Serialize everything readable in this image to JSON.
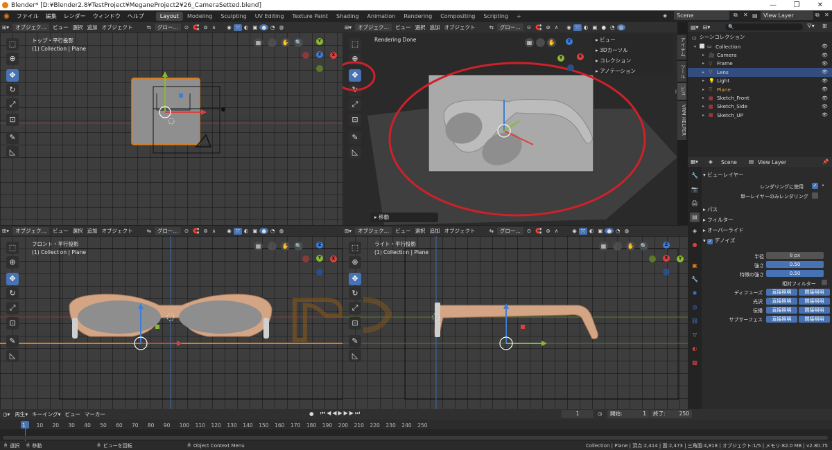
{
  "window": {
    "title": "Blender* [D:¥Blender2.8¥TestProject¥MeganeProject2¥26_CameraSetted.blend]",
    "minimize": "—",
    "maximize": "❐",
    "close": "✕"
  },
  "menu": [
    "ファイル",
    "編集",
    "レンダー",
    "ウィンドウ",
    "ヘルプ"
  ],
  "workspaces": [
    "Layout",
    "Modeling",
    "Sculpting",
    "UV Editing",
    "Texture Paint",
    "Shading",
    "Animation",
    "Rendering",
    "Compositing",
    "Scripting"
  ],
  "workspace_add": "+",
  "scene_name": "Scene",
  "view_layer": "View Layer",
  "vp_header": {
    "mode": "オブジェク…",
    "view": "ビュー",
    "select": "選択",
    "add": "追加",
    "object": "オブジェクト",
    "orientation": "グロー…"
  },
  "top_vp": {
    "view_name": "トップ・平行投影",
    "collection": "(1) Collection | Plane"
  },
  "cam_vp": {
    "status": "Rendering Done",
    "panel_items": [
      "ビュー",
      "3Dカーソル",
      "コレクション",
      "アノテーション"
    ],
    "op_panel": "移動"
  },
  "front_vp": {
    "view_name": "フロント・平行投影",
    "collection": "(1) Collection | Plane"
  },
  "right_vp": {
    "view_name": "ライト・平行投影",
    "collection": "(1) Collection | Plane"
  },
  "side_tabs": [
    "アイテム",
    "ツール",
    "ビュー",
    "VRM HELPER"
  ],
  "gizmo_axes": {
    "x": "X",
    "y": "Y",
    "z": "Z"
  },
  "outliner": {
    "scene_collection": "シーンコレクション",
    "items": [
      {
        "name": "Collection",
        "color": "#dddddd"
      },
      {
        "name": "Camera",
        "color": "#dddddd"
      },
      {
        "name": "Frame",
        "color": "#dddddd"
      },
      {
        "name": "Lens",
        "color": "#dddddd"
      },
      {
        "name": "Light",
        "color": "#dddddd"
      },
      {
        "name": "Plane",
        "color": "#e8a050"
      },
      {
        "name": "Sketch_Front",
        "color": "#dddddd"
      },
      {
        "name": "Sketch_Side",
        "color": "#dddddd"
      },
      {
        "name": "Sketch_UP",
        "color": "#dddddd"
      }
    ]
  },
  "properties": {
    "scene": "Scene",
    "view_layer": "View Layer",
    "section_view_layer": "ビューレイヤー",
    "use_for_render": "レンダリングに使用",
    "single_layer": "単一レイヤーのみレンダリング",
    "passes": "パス",
    "filter": "フィルター",
    "override": "オーバーライド",
    "denoise": "デノイズ",
    "radius_label": "半径",
    "radius_value": "8 px",
    "strength_label": "強さ",
    "strength_value": "0.50",
    "feature_strength_label": "特徴の強さ",
    "feature_strength_value": "0.50",
    "relative_filter": "相対フィルター",
    "rows": [
      {
        "label": "ディフューズ",
        "a": "直接照明",
        "b": "間接照明"
      },
      {
        "label": "光沢",
        "a": "直接照明",
        "b": "間接照明"
      },
      {
        "label": "伝播",
        "a": "直接照明",
        "b": "間接照明"
      },
      {
        "label": "サブサーフェス",
        "a": "直接照明",
        "b": "間接照明"
      }
    ]
  },
  "timeline": {
    "menu": [
      "再生",
      "キーイング",
      "ビュー",
      "マーカー"
    ],
    "current_frame": "1",
    "start_label": "開始:",
    "start": "1",
    "end_label": "終了:",
    "end": "250",
    "frame_numbers": [
      "1",
      "10",
      "20",
      "30",
      "40",
      "50",
      "60",
      "70",
      "80",
      "90",
      "100",
      "110",
      "120",
      "130",
      "140",
      "150",
      "160",
      "170",
      "180",
      "190",
      "200",
      "210",
      "220",
      "230",
      "240",
      "250"
    ]
  },
  "status": {
    "select": "選択",
    "move": "移動",
    "rotate_view": "ビューを回転",
    "context_menu": "Object Context Menu",
    "stats": "Collection | Plane | 頂点:2,414 | 面:2,473 | 三角面:4,818 | オブジェクト:1/5 | メモリ:82.0 MB | v2.80.75"
  },
  "colors": {
    "accent": "#4772b3",
    "orange": "#e87d0d",
    "annotation_red": "#d0202a",
    "x_axis": "#d94141",
    "y_axis": "#8ab833",
    "z_axis": "#3d7dd8"
  }
}
